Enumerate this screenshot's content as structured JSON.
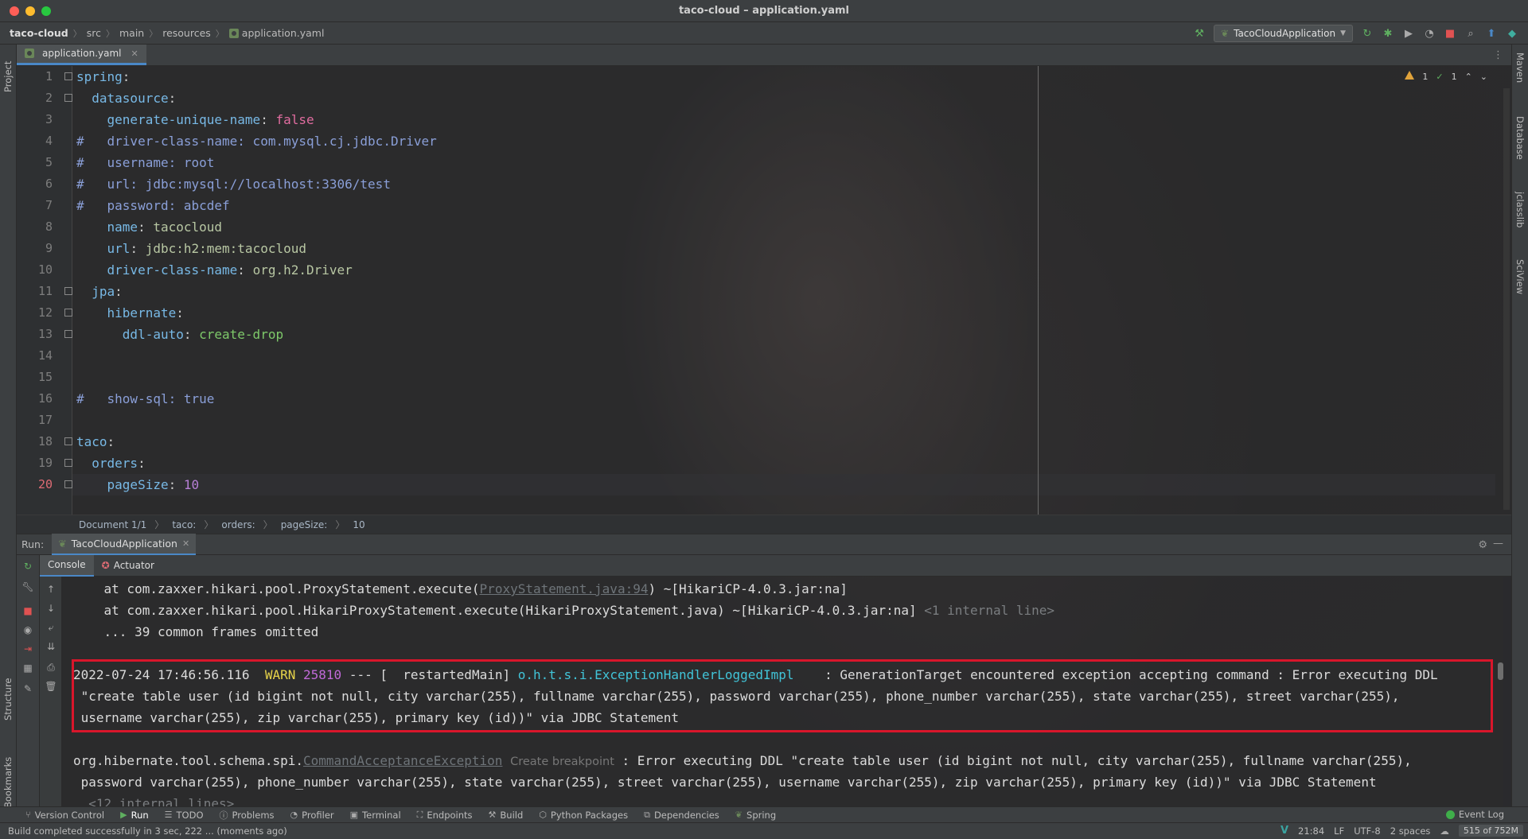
{
  "window": {
    "title": "taco-cloud – application.yaml"
  },
  "navbar": {
    "breadcrumbs": [
      "taco-cloud",
      "src",
      "main",
      "resources",
      "application.yaml"
    ],
    "run_config": "TacoCloudApplication"
  },
  "left_strip": {
    "project": "Project",
    "structure": "Structure",
    "bookmarks": "Bookmarks"
  },
  "right_strip": {
    "maven": "Maven",
    "database": "Database",
    "jclasslib": "jclasslib",
    "sciview": "SciView"
  },
  "editor": {
    "tab": "application.yaml",
    "inspections": {
      "warnings": "1",
      "ok": "1"
    },
    "lines": [
      {
        "n": "1"
      },
      {
        "n": "2"
      },
      {
        "n": "3"
      },
      {
        "n": "4"
      },
      {
        "n": "5"
      },
      {
        "n": "6"
      },
      {
        "n": "7"
      },
      {
        "n": "8"
      },
      {
        "n": "9"
      },
      {
        "n": "10"
      },
      {
        "n": "11"
      },
      {
        "n": "12"
      },
      {
        "n": "13"
      },
      {
        "n": "14"
      },
      {
        "n": "15"
      },
      {
        "n": "16"
      },
      {
        "n": "17"
      },
      {
        "n": "18"
      },
      {
        "n": "19"
      },
      {
        "n": "20"
      }
    ],
    "code": {
      "l1_key": "spring",
      "l2_key": "datasource",
      "l3_key": "generate-unique-name",
      "l3_val": "false",
      "l4": "#   driver-class-name: com.mysql.cj.jdbc.Driver",
      "l5": "#   username: root",
      "l6": "#   url: jdbc:mysql://localhost:3306/test",
      "l7": "#   password: abcdef",
      "l8_key": "name",
      "l8_val": "tacocloud",
      "l9_key": "url",
      "l9_val": "jdbc:h2:mem:tacocloud",
      "l10_key": "driver-class-name",
      "l10_val": "org.h2.Driver",
      "l11_key": "jpa",
      "l12_key": "hibernate",
      "l13_key": "ddl-auto",
      "l13_val": "create-drop",
      "l16": "#   show-sql: true",
      "l18_key": "taco",
      "l19_key": "orders",
      "l20_key": "pageSize",
      "l20_val": "10"
    },
    "breadcrumb": [
      "Document 1/1",
      "taco:",
      "orders:",
      "pageSize:",
      "10"
    ]
  },
  "run": {
    "label": "Run:",
    "tab": "TacoCloudApplication",
    "subtabs": {
      "console": "Console",
      "actuator": "Actuator"
    },
    "console": {
      "line1_pre": "at com.zaxxer.hikari.pool.ProxyStatement.execute(",
      "line1_link": "ProxyStatement.java:94",
      "line1_post": ") ~[HikariCP-4.0.3.jar:na]",
      "line2_pre": "at com.zaxxer.hikari.pool.HikariProxyStatement.execute(HikariProxyStatement.java) ~[HikariCP-4.0.3.jar:na] ",
      "line2_dim": "<1 internal line>",
      "line3": "... 39 common frames omitted",
      "log_ts": "2022-07-24 17:46:56.116",
      "log_level": "WARN",
      "log_pid": "25810",
      "log_thread": "--- [  restartedMain]",
      "log_logger": "o.h.t.s.i.ExceptionHandlerLoggedImpl",
      "log_msg": "    : GenerationTarget encountered exception accepting command : Error executing DDL",
      "log_msg2": " \"create table user (id bigint not null, city varchar(255), fullname varchar(255), password varchar(255), phone_number varchar(255), state varchar(255), street varchar(255),",
      "log_msg3": " username varchar(255), zip varchar(255), primary key (id))\" via JDBC Statement",
      "exc_pre": "org.hibernate.tool.schema.spi.",
      "exc_link": "CommandAcceptanceException",
      "exc_hint": "Create breakpoint",
      "exc_post": " : Error executing DDL \"create table user (id bigint not null, city varchar(255), fullname varchar(255),",
      "exc_line2": " password varchar(255), phone_number varchar(255), state varchar(255), street varchar(255), username varchar(255), zip varchar(255), primary key (id))\" via JDBC Statement",
      "exc_line3": "  <12 internal lines>"
    }
  },
  "tool_windows": [
    "Version Control",
    "Run",
    "TODO",
    "Problems",
    "Profiler",
    "Terminal",
    "Endpoints",
    "Build",
    "Python Packages",
    "Dependencies",
    "Spring"
  ],
  "event_log": "Event Log",
  "status": {
    "message": "Build completed successfully in 3 sec, 222 ... (moments ago)",
    "position": "21:84",
    "line_sep": "LF",
    "encoding": "UTF-8",
    "indent": "2 spaces",
    "memory": "515 of 752M"
  }
}
